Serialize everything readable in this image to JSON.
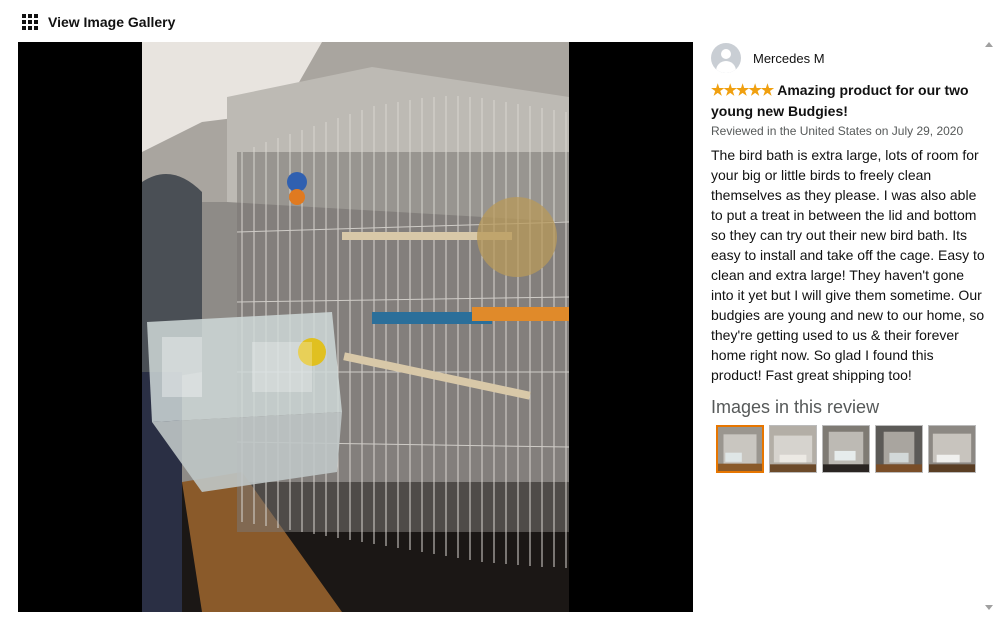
{
  "header": {
    "gallery_label": "View Image Gallery",
    "icon": "grid-icon"
  },
  "review": {
    "author": "Mercedes M",
    "rating": 5,
    "stars": "★★★★★",
    "title": "Amazing product for our two young new Budgies!",
    "meta": "Reviewed in the United States on July 29, 2020",
    "body": "The bird bath is extra large, lots of room for your big or little birds to freely clean themselves as they please. I was also able to put a treat in between the lid and bottom so they can try out their new bird bath. Its easy to install and take off the cage. Easy to clean and extra large! They haven't gone into it yet but I will give them sometime. Our budgies are young and new to our home, so they're getting used to us & their forever home right now. So glad I found this product! Fast great shipping too!"
  },
  "images": {
    "heading": "Images in this review",
    "count": 5,
    "selected_index": 0
  },
  "colors": {
    "accent": "#e77600",
    "star": "#f0a010",
    "meta_text": "#565959"
  }
}
